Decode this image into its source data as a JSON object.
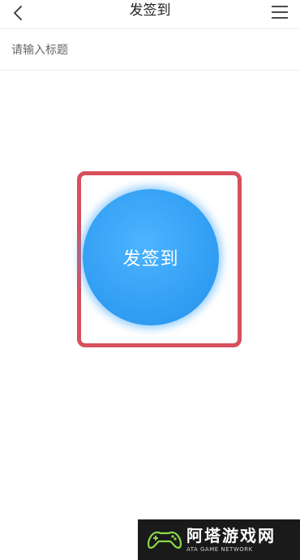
{
  "header": {
    "title": "发签到",
    "back_icon": "chevron-left-icon",
    "menu_icon": "hamburger-menu-icon"
  },
  "form": {
    "title_placeholder": "请输入标题",
    "title_value": ""
  },
  "sign_button": {
    "label": "发签到",
    "color": "#2f9cf2"
  },
  "annotation": {
    "highlight_color": "#d6505e"
  },
  "watermark": {
    "main_text": "阿塔游戏网",
    "sub_text": "ATA GAME NETWORK"
  }
}
